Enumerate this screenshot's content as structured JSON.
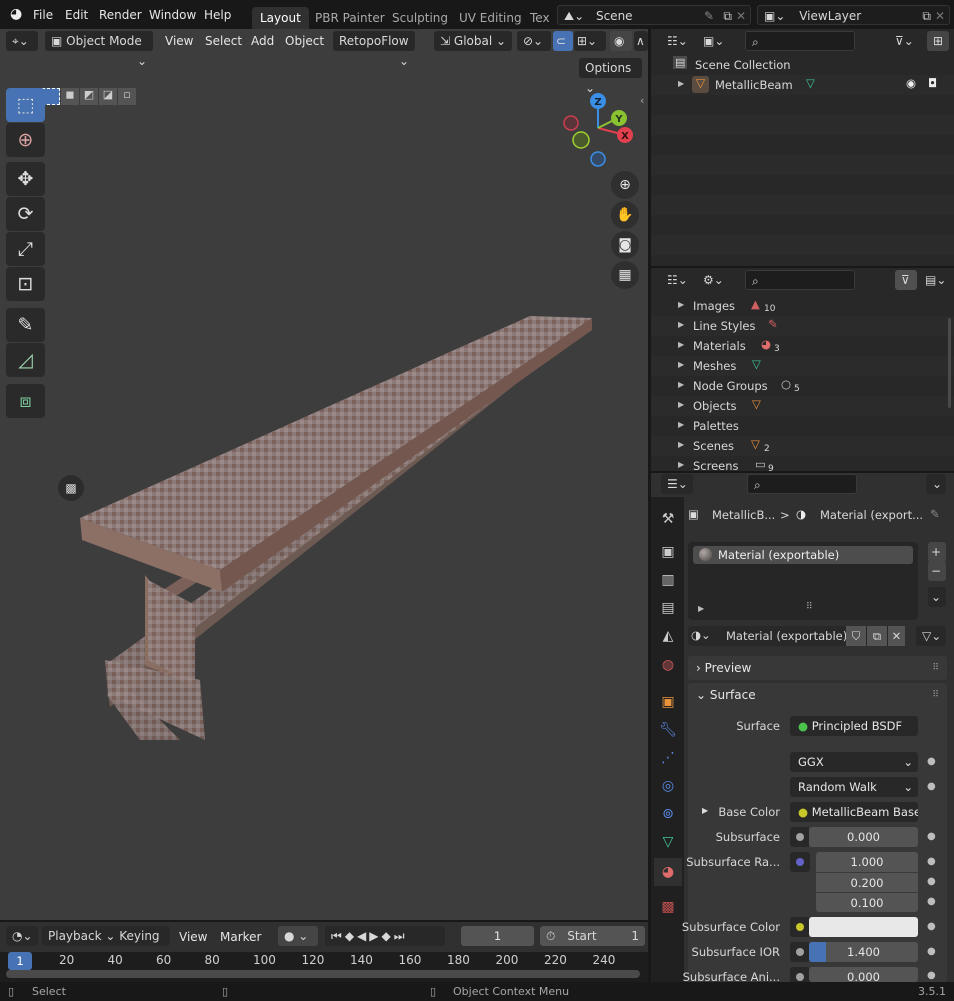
{
  "app": {
    "version": "3.5.1"
  },
  "topbar": {
    "menus": [
      "File",
      "Edit",
      "Render",
      "Window",
      "Help"
    ],
    "workspace_tabs": [
      {
        "label": "Layout",
        "active": true
      },
      {
        "label": "PBR Painter",
        "active": false
      },
      {
        "label": "Sculpting",
        "active": false
      },
      {
        "label": "UV Editing",
        "active": false
      },
      {
        "label": "Tex",
        "active": false
      }
    ],
    "scene": "Scene",
    "view_layer": "ViewLayer"
  },
  "viewport": {
    "mode": "Object Mode",
    "menus": [
      "View",
      "Select",
      "Add",
      "Object"
    ],
    "addon_menu": "RetopoFlow",
    "transform_orientation": "Global",
    "options_label": "Options",
    "tools": [
      "select-box",
      "cursor",
      "move",
      "rotate",
      "scale",
      "transform",
      "annotate",
      "measure",
      "add-cube"
    ],
    "gizmo_axes": [
      "Z",
      "Y",
      "X"
    ],
    "nav_buttons": [
      "zoom",
      "pan",
      "camera",
      "perspective"
    ],
    "object_name": "MetallicBeam"
  },
  "outliner": {
    "search_placeholder": "",
    "root": "Scene Collection",
    "items": [
      {
        "name": "MetallicBeam",
        "type": "mesh-object"
      }
    ]
  },
  "data_api": {
    "items": [
      {
        "label": "Images",
        "count": "10"
      },
      {
        "label": "Line Styles",
        "count": ""
      },
      {
        "label": "Materials",
        "count": "3"
      },
      {
        "label": "Meshes",
        "count": ""
      },
      {
        "label": "Node Groups",
        "count": "5"
      },
      {
        "label": "Objects",
        "count": ""
      },
      {
        "label": "Palettes",
        "count": ""
      },
      {
        "label": "Scenes",
        "count": "2"
      },
      {
        "label": "Screens",
        "count": "9"
      }
    ]
  },
  "properties": {
    "breadcrumb": {
      "object": "MetallicB...",
      "separator": ">",
      "material": "Material (export..."
    },
    "material_slots": [
      "Material (exportable)"
    ],
    "material_name": "Material (exportable)",
    "sections": {
      "preview": "Preview",
      "surface": "Surface"
    },
    "surface": {
      "surface_label": "Surface",
      "surface_value": "Principled BSDF",
      "distribution": "GGX",
      "subsurface_method": "Random Walk",
      "fields": [
        {
          "label": "Base Color",
          "value": "MetallicBeam Base...",
          "socket": "#c7c729"
        },
        {
          "label": "Subsurface",
          "value": "0.000",
          "socket": "#a1a1a1"
        },
        {
          "label": "Subsurface Ra...",
          "values": [
            "1.000",
            "0.200",
            "0.100"
          ],
          "socket": "#6363c7"
        },
        {
          "label": "Subsurface Color",
          "value": "",
          "socket": "#c7c729",
          "swatch": "#e8e8e8"
        },
        {
          "label": "Subsurface IOR",
          "value": "1.400",
          "socket": "#a1a1a1",
          "fill": 0.04
        },
        {
          "label": "Subsurface Ani...",
          "value": "0.000",
          "socket": "#a1a1a1"
        }
      ]
    }
  },
  "timeline": {
    "menus": [
      "Playback",
      "Keying",
      "View",
      "Marker"
    ],
    "current_frame": "1",
    "start_label": "Start",
    "start_value": "1",
    "ticks": [
      "20",
      "40",
      "60",
      "80",
      "100",
      "120",
      "140",
      "160",
      "180",
      "200",
      "220",
      "240"
    ],
    "playhead": "1"
  },
  "statusbar": {
    "left": "Select",
    "right": "Object Context Menu",
    "version": "3.5.1"
  },
  "colors": {
    "accent": "#4772b3",
    "x_axis": "#e2404f",
    "y_axis": "#8bc230",
    "z_axis": "#3a8ee6",
    "mesh": "#3dc49a",
    "material": "#e06b6b"
  }
}
